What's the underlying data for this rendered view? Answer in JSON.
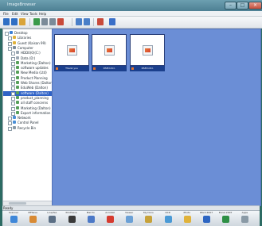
{
  "window": {
    "title": "ImageBrowser"
  },
  "menu": [
    "File",
    "Edit",
    "View",
    "Tools",
    "Help"
  ],
  "toolbar": {
    "icons": [
      "back-icon",
      "forward-icon",
      "up-folder-icon",
      "refresh-icon",
      "copy-icon",
      "paste-icon",
      "delete-icon",
      "rotate-left-icon",
      "rotate-right-icon",
      "settings-icon",
      "help-icon"
    ]
  },
  "tree": {
    "items": [
      {
        "label": "Desktop",
        "indent": 0,
        "color": "#3a7fd5"
      },
      {
        "label": "Libraries",
        "indent": 1,
        "color": "#e0b23a"
      },
      {
        "label": "Guest (Kaisan 99)",
        "indent": 1,
        "color": "#e0b23a"
      },
      {
        "label": "Computer",
        "indent": 1,
        "color": "#7d8c99"
      },
      {
        "label": "HDD0(0)(C:)",
        "indent": 2,
        "color": "#9aa7b3"
      },
      {
        "label": "Data (D:)",
        "indent": 2,
        "color": "#9aa7b3"
      },
      {
        "label": "Marketing (Dalton)",
        "indent": 2,
        "color": "#57a05a"
      },
      {
        "label": "software updates",
        "indent": 2,
        "color": "#57a05a"
      },
      {
        "label": "New Media (Ltd)",
        "indent": 2,
        "color": "#57a05a"
      },
      {
        "label": "Product Planning",
        "indent": 2,
        "color": "#57a05a"
      },
      {
        "label": "Web Shares (Dalton)",
        "indent": 2,
        "color": "#57a05a"
      },
      {
        "label": "EduWeb (Dalton)",
        "indent": 2,
        "color": "#57a05a"
      },
      {
        "label": "software (Dalton)",
        "indent": 2,
        "color": "#57a05a",
        "selected": true
      },
      {
        "label": "product_planning",
        "indent": 2,
        "color": "#57a05a"
      },
      {
        "label": "all staff concerns",
        "indent": 2,
        "color": "#57a05a"
      },
      {
        "label": "Marketing (Dalton)",
        "indent": 2,
        "color": "#57a05a"
      },
      {
        "label": "Export information",
        "indent": 2,
        "color": "#57a05a"
      },
      {
        "label": "Network",
        "indent": 1,
        "color": "#4a8fd6"
      },
      {
        "label": "Control Panel",
        "indent": 1,
        "color": "#4a8fd6"
      },
      {
        "label": "Recycle Bin",
        "indent": 1,
        "color": "#8a9aa6"
      }
    ]
  },
  "files": [
    {
      "caption": "Thank you"
    },
    {
      "caption": "DSM Intro"
    },
    {
      "caption": "DSM Intro"
    }
  ],
  "status": {
    "text": "Ready"
  },
  "dock": {
    "items": [
      {
        "label": "Scanner",
        "color": "#3f87d8"
      },
      {
        "label": "MFSave",
        "color": "#d88a34"
      },
      {
        "label": "Line/fax",
        "color": "#5b6f85"
      },
      {
        "label": "PrintSave",
        "color": "#3a3a3a"
      },
      {
        "label": "Mail to",
        "color": "#4c79c7"
      },
      {
        "label": "Acrobat",
        "color": "#d63b2f"
      },
      {
        "label": "Viewer",
        "color": "#6aa0d6"
      },
      {
        "label": "My Docs",
        "color": "#c7a23a"
      },
      {
        "label": "OCR",
        "color": "#4a9ad6"
      },
      {
        "label": "Photo",
        "color": "#e0b23a"
      },
      {
        "label": "Word 2007",
        "color": "#2d65c2"
      },
      {
        "label": "Excel 2007",
        "color": "#2e8f45"
      },
      {
        "label": "Apps",
        "color": "#8a9aa6"
      }
    ]
  }
}
